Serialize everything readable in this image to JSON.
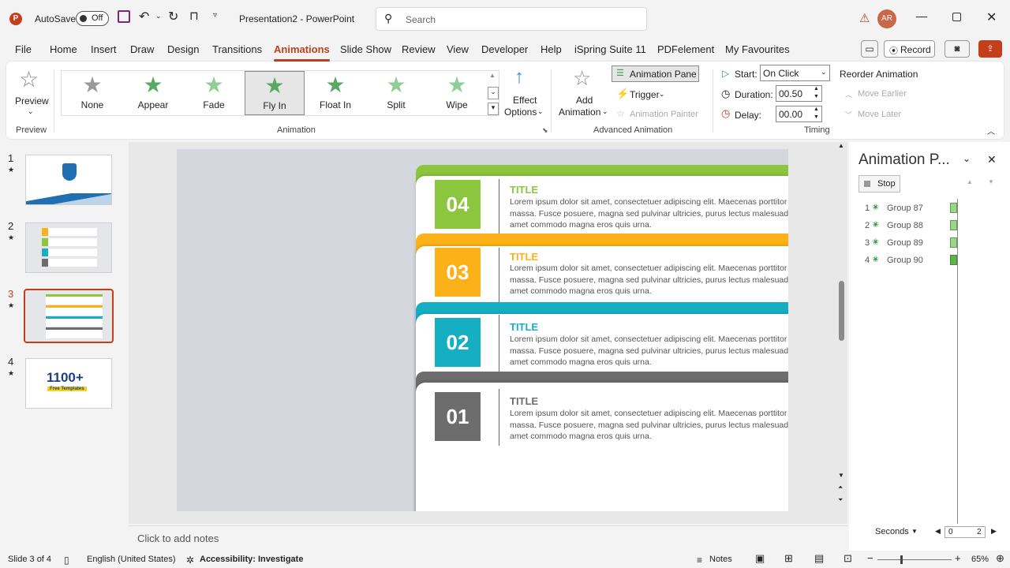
{
  "colors": {
    "accent": "#c43e1c",
    "green": "#8cc63f",
    "orange": "#fbb117",
    "teal": "#16aec3",
    "gray": "#6d6d6d"
  },
  "title": {
    "autosave_label": "AutoSave",
    "autosave_state": "Off",
    "doc_title": "Presentation2  -  PowerPoint",
    "search_placeholder": "Search",
    "avatar_initials": "AR"
  },
  "menu": {
    "tabs": [
      "File",
      "Home",
      "Insert",
      "Draw",
      "Design",
      "Transitions",
      "Animations",
      "Slide Show",
      "Review",
      "View",
      "Developer",
      "Help",
      "iSpring Suite 11",
      "PDFelement",
      "My Favourites"
    ],
    "record_label": "Record"
  },
  "ribbon": {
    "preview_label": "Preview",
    "preview_group": "Preview",
    "animations": [
      "None",
      "Appear",
      "Fade",
      "Fly In",
      "Float In",
      "Split",
      "Wipe"
    ],
    "selected_animation": "Fly In",
    "effect_options_1": "Effect",
    "effect_options_2": "Options",
    "animation_group": "Animation",
    "add_animation_1": "Add",
    "add_animation_2": "Animation",
    "animation_pane": "Animation Pane",
    "trigger": "Trigger",
    "animation_painter": "Animation Painter",
    "advanced_group": "Advanced Animation",
    "start_label": "Start:",
    "start_value": "On Click",
    "duration_label": "Duration:",
    "duration_value": "00.50",
    "delay_label": "Delay:",
    "delay_value": "00.00",
    "reorder_label": "Reorder Animation",
    "move_earlier": "Move Earlier",
    "move_later": "Move Later",
    "timing_group": "Timing"
  },
  "slides": {
    "numbers": [
      "1",
      "2",
      "3",
      "4"
    ],
    "thumb4_text": "1100+",
    "thumb4_sub": "Free Templates"
  },
  "slide": {
    "cards": [
      {
        "num": "04",
        "title": "TITLE",
        "text": "Lorem ipsum dolor sit amet, consectetuer adipiscing elit. Maecenas porttitor congue massa. Fusce posuere, magna sed pulvinar ultricies, purus lectus malesuada libero, sit amet commodo magna eros quis urna.",
        "icon": "pagoda-icon"
      },
      {
        "num": "03",
        "title": "TITLE",
        "text": "Lorem ipsum dolor sit amet, consectetuer adipiscing elit. Maecenas porttitor congue massa. Fusce posuere, magna sed pulvinar ultricies, purus lectus malesuada libero, sit amet commodo magna eros quis urna.",
        "icon": "apple-icon"
      },
      {
        "num": "02",
        "title": "TITLE",
        "text": "Lorem ipsum dolor sit amet, consectetuer adipiscing elit. Maecenas porttitor congue massa. Fusce posuere, magna sed pulvinar ultricies, purus lectus malesuada libero, sit amet commodo magna eros quis urna.",
        "icon": "alarm-clock-icon"
      },
      {
        "num": "01",
        "title": "TITLE",
        "text": "Lorem ipsum dolor sit amet, consectetuer adipiscing elit. Maecenas porttitor congue massa. Fusce posuere, magna sed pulvinar ultricies, purus lectus malesuada libero, sit amet commodo magna eros quis urna.",
        "icon": "aperture-icon"
      }
    ]
  },
  "notes_placeholder": "Click to add notes",
  "pane": {
    "title": "Animation P...",
    "stop": "Stop",
    "items": [
      {
        "n": "1",
        "name": "Group 87"
      },
      {
        "n": "2",
        "name": "Group 88"
      },
      {
        "n": "3",
        "name": "Group 89"
      },
      {
        "n": "4",
        "name": "Group 90"
      }
    ],
    "seconds": "Seconds",
    "timeline_start": "0",
    "timeline_end": "2"
  },
  "status": {
    "slide_info": "Slide 3 of 4",
    "language": "English (United States)",
    "accessibility": "Accessibility: Investigate",
    "notes": "Notes",
    "zoom": "65%"
  }
}
